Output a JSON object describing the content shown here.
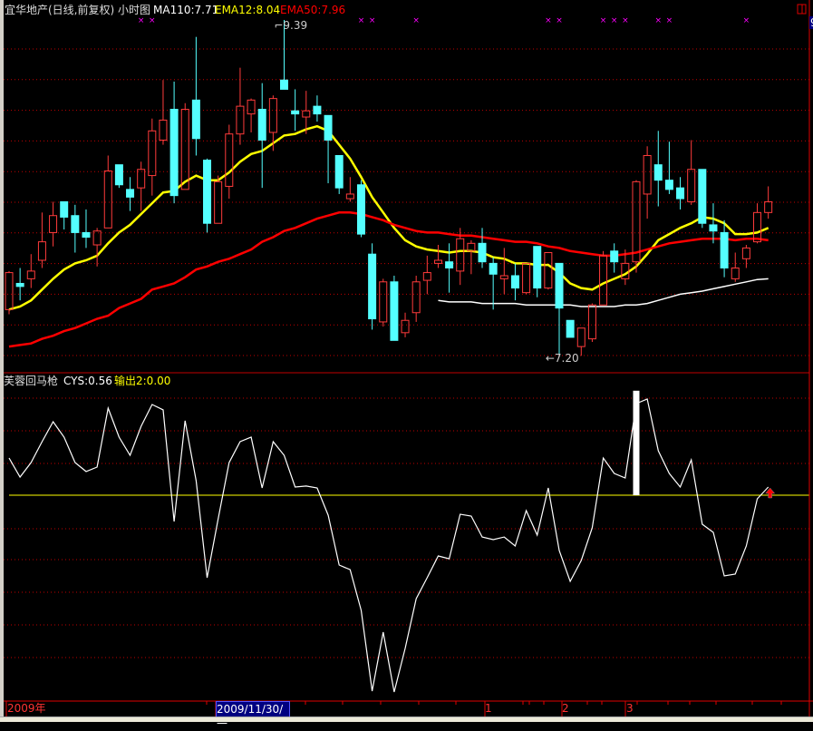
{
  "header": {
    "title": "宜华地产(日线,前复权) 小时图",
    "ma110": "MA110:7.71",
    "ema12": "EMA12:8.04",
    "ema50": "EMA50:7.96"
  },
  "indicator_header": {
    "name": "芙蓉回马枪",
    "cys": "CYS:0.56",
    "output_label": "输出",
    "output_value": "2:0.00"
  },
  "axis": {
    "year": "2009年",
    "cursor_date": "2009/11/30/一",
    "months": [
      "1",
      "2",
      "3"
    ],
    "right_label": "9"
  },
  "colors": {
    "up": "#ff3b3b",
    "down": "#54ffff",
    "ema12": "#ffff00",
    "ema50": "#ff0000",
    "ma110": "#ffffff",
    "grid": "#c00000",
    "signal": "#ff00ff"
  },
  "chart_data": [
    {
      "type": "candlestick",
      "title": "宜华地产(日线,前复权) 小时图",
      "high_label": "9.39",
      "low_label": "7.20",
      "high_index": 25,
      "low_index": 50,
      "ylim": [
        7.15,
        9.45
      ],
      "candles_ochl_fields": [
        "open",
        "close",
        "high",
        "low"
      ],
      "candles": [
        [
          7.51,
          7.75,
          7.76,
          7.48
        ],
        [
          7.68,
          7.66,
          7.78,
          7.57
        ],
        [
          7.71,
          7.76,
          7.87,
          7.65
        ],
        [
          7.83,
          7.95,
          8.14,
          7.78
        ],
        [
          8.01,
          8.12,
          8.21,
          7.92
        ],
        [
          8.21,
          8.11,
          8.21,
          8.03
        ],
        [
          8.12,
          8.01,
          8.19,
          7.88
        ],
        [
          8.01,
          7.98,
          8.16,
          7.91
        ],
        [
          7.93,
          8.02,
          8.04,
          7.79
        ],
        [
          8.04,
          8.41,
          8.51,
          8.04
        ],
        [
          8.45,
          8.32,
          8.45,
          8.3
        ],
        [
          8.29,
          8.24,
          8.37,
          8.15
        ],
        [
          8.3,
          8.42,
          8.47,
          8.15
        ],
        [
          8.38,
          8.67,
          8.75,
          8.25
        ],
        [
          8.61,
          8.74,
          9.0,
          8.58
        ],
        [
          8.81,
          8.25,
          8.99,
          8.2
        ],
        [
          8.29,
          8.81,
          8.85,
          8.29
        ],
        [
          8.87,
          8.62,
          9.28,
          8.51
        ],
        [
          8.48,
          8.07,
          8.49,
          8.01
        ],
        [
          8.07,
          8.34,
          8.38,
          8.07
        ],
        [
          8.31,
          8.65,
          8.71,
          8.23
        ],
        [
          8.65,
          8.83,
          9.08,
          8.58
        ],
        [
          8.78,
          8.87,
          8.88,
          8.66
        ],
        [
          8.81,
          8.61,
          8.98,
          8.3
        ],
        [
          8.66,
          8.88,
          8.9,
          8.54
        ],
        [
          9.0,
          8.94,
          9.39,
          8.94
        ],
        [
          8.8,
          8.78,
          8.94,
          8.67
        ],
        [
          8.76,
          8.8,
          8.93,
          8.65
        ],
        [
          8.83,
          8.78,
          8.9,
          8.73
        ],
        [
          8.77,
          8.61,
          8.77,
          8.33
        ],
        [
          8.51,
          8.3,
          8.51,
          8.26
        ],
        [
          8.23,
          8.26,
          8.37,
          8.21
        ],
        [
          8.32,
          8.0,
          8.35,
          7.98
        ],
        [
          7.87,
          7.45,
          7.94,
          7.38
        ],
        [
          7.43,
          7.69,
          7.71,
          7.4
        ],
        [
          7.69,
          7.31,
          7.73,
          7.31
        ],
        [
          7.36,
          7.44,
          7.49,
          7.33
        ],
        [
          7.49,
          7.69,
          7.73,
          7.43
        ],
        [
          7.7,
          7.75,
          7.86,
          7.61
        ],
        [
          7.81,
          7.83,
          7.93,
          7.78
        ],
        [
          7.82,
          7.78,
          7.94,
          7.62
        ],
        [
          7.76,
          7.97,
          8.04,
          7.67
        ],
        [
          7.89,
          7.94,
          7.96,
          7.74
        ],
        [
          7.94,
          7.82,
          8.04,
          7.78
        ],
        [
          7.81,
          7.74,
          7.85,
          7.51
        ],
        [
          7.71,
          7.73,
          7.91,
          7.61
        ],
        [
          7.73,
          7.65,
          7.81,
          7.57
        ],
        [
          7.62,
          7.81,
          7.81,
          7.61
        ],
        [
          7.92,
          7.65,
          7.92,
          7.59
        ],
        [
          7.65,
          7.88,
          7.88,
          7.64
        ],
        [
          7.81,
          7.52,
          7.81,
          7.2
        ],
        [
          7.44,
          7.33,
          7.44,
          7.33
        ],
        [
          7.27,
          7.39,
          7.39,
          7.21
        ],
        [
          7.32,
          7.54,
          7.55,
          7.3
        ],
        [
          7.54,
          7.86,
          7.89,
          7.54
        ],
        [
          7.89,
          7.82,
          7.94,
          7.75
        ],
        [
          7.71,
          7.81,
          7.9,
          7.67
        ],
        [
          7.82,
          8.34,
          8.35,
          7.75
        ],
        [
          8.26,
          8.51,
          8.57,
          8.1
        ],
        [
          8.45,
          8.35,
          8.67,
          8.18
        ],
        [
          8.35,
          8.29,
          8.6,
          8.26
        ],
        [
          8.3,
          8.23,
          8.37,
          8.16
        ],
        [
          8.21,
          8.42,
          8.61,
          8.19
        ],
        [
          8.42,
          8.07,
          8.42,
          8.04
        ],
        [
          8.06,
          8.02,
          8.2,
          7.94
        ],
        [
          8.01,
          7.78,
          8.09,
          7.72
        ],
        [
          7.71,
          7.78,
          7.88,
          7.69
        ],
        [
          7.84,
          7.91,
          7.93,
          7.78
        ],
        [
          7.95,
          8.14,
          8.2,
          7.94
        ],
        [
          8.14,
          8.21,
          8.31,
          8.1
        ]
      ],
      "series": [
        {
          "name": "EMA12",
          "values": [
            7.51,
            7.53,
            7.57,
            7.64,
            7.71,
            7.77,
            7.81,
            7.83,
            7.86,
            7.94,
            8.01,
            8.06,
            8.13,
            8.2,
            8.27,
            8.28,
            8.34,
            8.38,
            8.35,
            8.35,
            8.4,
            8.47,
            8.52,
            8.54,
            8.59,
            8.64,
            8.65,
            8.68,
            8.7,
            8.67,
            8.58,
            8.49,
            8.37,
            8.24,
            8.14,
            8.04,
            7.96,
            7.92,
            7.9,
            7.89,
            7.88,
            7.89,
            7.89,
            7.88,
            7.85,
            7.84,
            7.81,
            7.81,
            7.8,
            7.8,
            7.75,
            7.68,
            7.65,
            7.64,
            7.68,
            7.71,
            7.74,
            7.79,
            7.87,
            7.96,
            8.0,
            8.04,
            8.07,
            8.11,
            8.1,
            8.07,
            8.0,
            8.0,
            8.01,
            8.04
          ]
        },
        {
          "name": "EMA50",
          "values": [
            7.27,
            7.28,
            7.29,
            7.32,
            7.34,
            7.37,
            7.39,
            7.42,
            7.45,
            7.47,
            7.52,
            7.55,
            7.58,
            7.64,
            7.66,
            7.68,
            7.72,
            7.77,
            7.79,
            7.82,
            7.84,
            7.87,
            7.9,
            7.95,
            7.98,
            8.02,
            8.04,
            8.07,
            8.1,
            8.12,
            8.14,
            8.14,
            8.13,
            8.11,
            8.09,
            8.06,
            8.04,
            8.02,
            8.01,
            8.01,
            8.0,
            7.99,
            7.99,
            7.98,
            7.97,
            7.96,
            7.95,
            7.95,
            7.94,
            7.92,
            7.91,
            7.89,
            7.88,
            7.87,
            7.86,
            7.86,
            7.87,
            7.88,
            7.9,
            7.92,
            7.94,
            7.95,
            7.96,
            7.97,
            7.97,
            7.97,
            7.96,
            7.97,
            7.97,
            7.96
          ]
        },
        {
          "name": "MA110",
          "values": [
            null,
            null,
            null,
            null,
            null,
            null,
            null,
            null,
            null,
            null,
            null,
            null,
            null,
            null,
            null,
            null,
            null,
            null,
            null,
            null,
            null,
            null,
            null,
            null,
            null,
            null,
            null,
            null,
            null,
            null,
            null,
            null,
            null,
            null,
            null,
            null,
            null,
            null,
            null,
            7.57,
            7.56,
            7.56,
            7.56,
            7.55,
            7.55,
            7.55,
            7.55,
            7.54,
            7.54,
            7.54,
            7.54,
            7.54,
            7.53,
            7.53,
            7.53,
            7.53,
            7.54,
            7.54,
            7.55,
            7.57,
            7.59,
            7.61,
            7.62,
            7.63,
            7.645,
            7.66,
            7.675,
            7.69,
            7.705,
            7.71
          ]
        }
      ],
      "signal_markers_index": [
        13,
        14,
        33,
        34,
        38,
        50,
        51,
        55,
        56,
        57,
        60,
        61,
        68
      ]
    },
    {
      "type": "line",
      "title": "芙蓉回马枪",
      "series": [
        {
          "name": "CYS",
          "values": [
            2.56,
            1.25,
            2.25,
            3.69,
            5.06,
            4.0,
            2.25,
            1.63,
            1.94,
            6.0,
            4.0,
            2.75,
            4.75,
            6.25,
            5.88,
            -1.81,
            5.13,
            1.0,
            -5.69,
            -1.63,
            2.25,
            3.69,
            4.0,
            0.5,
            3.69,
            2.75,
            0.56,
            0.63,
            0.5,
            -1.38,
            -4.81,
            -5.13,
            -7.94,
            -13.5,
            -9.44,
            -13.56,
            -10.56,
            -7.13,
            -5.69,
            -4.19,
            -4.38,
            -1.31,
            -1.44,
            -2.88,
            -3.06,
            -2.88,
            -3.5,
            -1.06,
            -2.75,
            0.5,
            -3.81,
            -5.94,
            -4.5,
            -2.25,
            2.56,
            1.5,
            1.19,
            6.31,
            6.63,
            3.06,
            1.5,
            0.56,
            2.44,
            -2.0,
            -2.56,
            -5.56,
            -5.44,
            -3.5,
            -0.25,
            0.56
          ]
        }
      ],
      "reference_line": 0,
      "output_bar": {
        "index": 58,
        "value": 7.2
      },
      "up_arrow_index": 70
    }
  ]
}
